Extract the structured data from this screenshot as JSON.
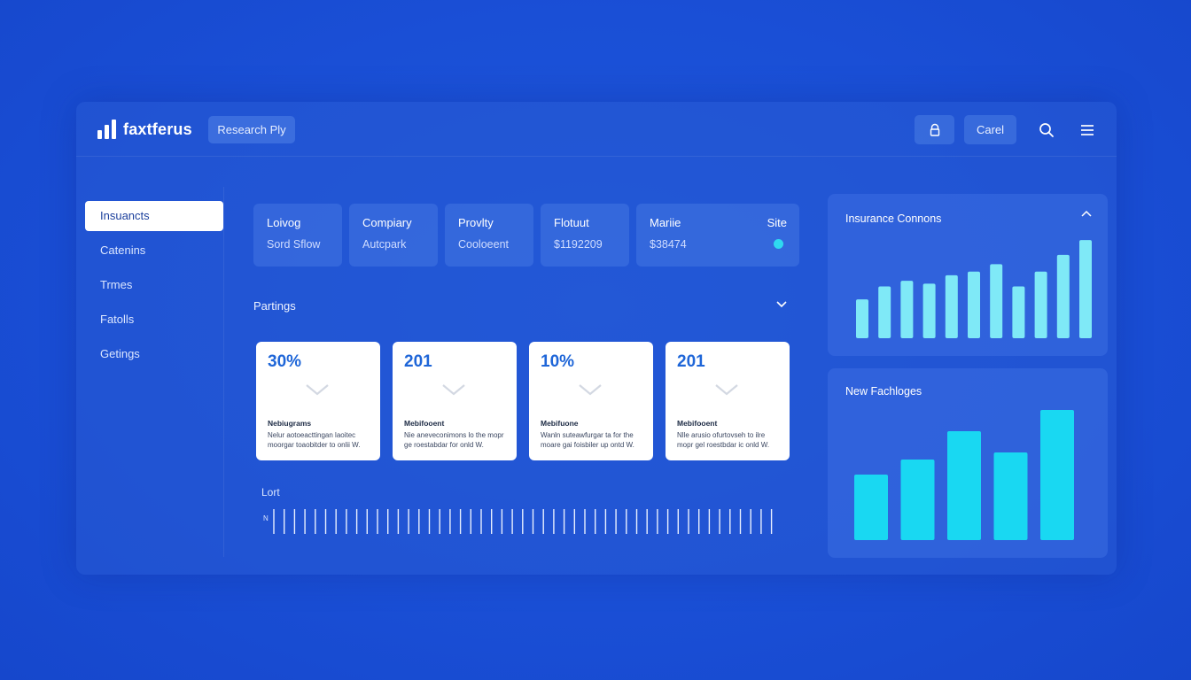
{
  "app": {
    "name": "faxtferus",
    "badge": "Research Ply"
  },
  "topbar": {
    "user_label": "Carel",
    "icons": [
      "lock-icon",
      "search-icon",
      "menu-icon"
    ]
  },
  "sidebar": {
    "items": [
      {
        "label": "Insuancts",
        "active": true
      },
      {
        "label": "Catenins",
        "active": false
      },
      {
        "label": "Trmes",
        "active": false
      },
      {
        "label": "Fatolls",
        "active": false
      },
      {
        "label": "Getings",
        "active": false
      }
    ]
  },
  "info": [
    {
      "label": "Loivog",
      "value": "Sord Sflow"
    },
    {
      "label": "Compiary",
      "value": "Autcpark"
    },
    {
      "label": "Provlty",
      "value": "Cooloeent"
    },
    {
      "label": "Flotuut",
      "value": "$1192209"
    },
    {
      "label": "Mariie",
      "value": "$38474",
      "site_label": "Site"
    }
  ],
  "section": {
    "title": "Partings"
  },
  "cards": [
    {
      "value": "30%",
      "title": "Nebiugrams",
      "desc": "Nelur aotoeacttingan laoitec moorgar toaobitder to onlii W."
    },
    {
      "value": "201",
      "title": "Mebifooent",
      "desc": "Nie aneveconimons lo the mopr ge roestabdar for onld W."
    },
    {
      "value": "10%",
      "title": "Mebifuone",
      "desc": "Wanln suteawfurgar ta for the moare gai foisbiler up ontd W."
    },
    {
      "value": "201",
      "title": "Mebifooent",
      "desc": "Nlle arusio ofurtovseh to ilre mopr gel roestbdar ic onld W."
    }
  ],
  "timeline": {
    "label": "Lort",
    "axis_label": "N"
  },
  "chart_data": [
    {
      "type": "bar",
      "title": "Insurance Connons",
      "values": [
        42,
        56,
        62,
        59,
        68,
        72,
        80,
        56,
        72,
        90,
        106
      ],
      "ylim": [
        0,
        110
      ],
      "color": "#7fe9f7"
    },
    {
      "type": "bar",
      "title": "New Fachloges",
      "values": [
        74,
        91,
        123,
        99,
        147
      ],
      "ylim": [
        0,
        150
      ],
      "color": "#19d8f2"
    }
  ],
  "colors": {
    "background": "#1a4fd6",
    "accent": "#1f66d8",
    "cyan": "#2fd9f0"
  }
}
